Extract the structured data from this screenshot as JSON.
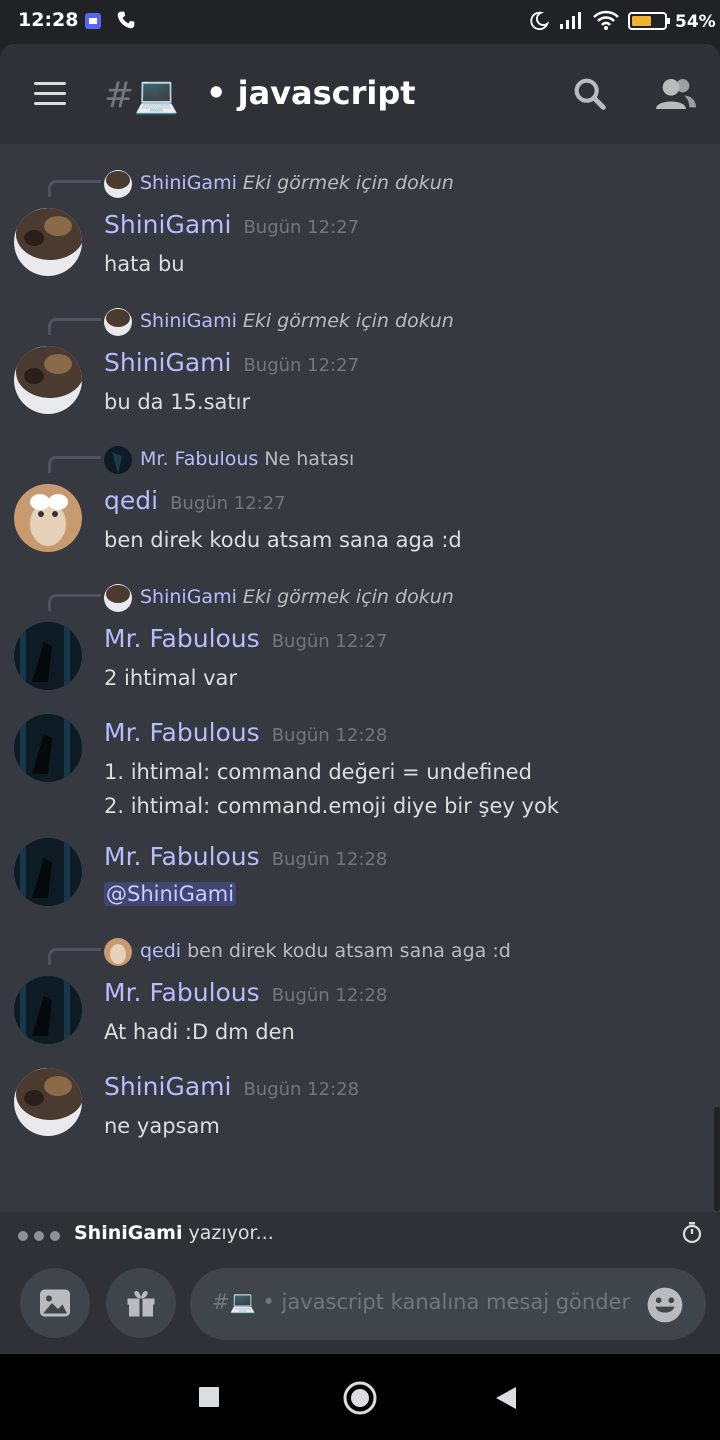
{
  "status_bar": {
    "time": "12:28",
    "battery": "54%"
  },
  "header": {
    "channel_prefix": "#💻",
    "channel_name": "• javascript"
  },
  "messages": [
    {
      "reply": {
        "name": "ShiniGami",
        "hint": "Eki görmek için dokun"
      },
      "author": "ShiniGami",
      "timestamp": "Bugün 12:27",
      "lines": [
        "hata bu"
      ]
    },
    {
      "reply": {
        "name": "ShiniGami",
        "hint": "Eki görmek için dokun"
      },
      "author": "ShiniGami",
      "timestamp": "Bugün 12:27",
      "lines": [
        "bu da 15.satır"
      ]
    },
    {
      "reply": {
        "name": "Mr. Fabulous",
        "content": "Ne hatası"
      },
      "author": "qedi",
      "timestamp": "Bugün 12:27",
      "lines": [
        "ben direk kodu atsam sana aga :d"
      ]
    },
    {
      "reply": {
        "name": "ShiniGami",
        "hint": "Eki görmek için dokun"
      },
      "author": "Mr. Fabulous",
      "timestamp": "Bugün 12:27",
      "lines": [
        "2 ihtimal var"
      ]
    },
    {
      "author": "Mr. Fabulous",
      "timestamp": "Bugün 12:28",
      "lines": [
        "1. ihtimal: command değeri = undefined",
        "2. ihtimal: command.emoji diye bir şey yok"
      ]
    },
    {
      "author": "Mr. Fabulous",
      "timestamp": "Bugün 12:28",
      "mention": "@ShiniGami"
    },
    {
      "reply": {
        "name": "qedi",
        "content": "ben direk kodu atsam sana aga :d"
      },
      "author": "Mr. Fabulous",
      "timestamp": "Bugün 12:28",
      "lines": [
        "At hadi :D dm den"
      ]
    },
    {
      "author": "ShiniGami",
      "timestamp": "Bugün 12:28",
      "lines": [
        "ne yapsam"
      ]
    }
  ],
  "typing": {
    "user": "ShiniGami",
    "suffix": "yazıyor..."
  },
  "composer": {
    "placeholder": "#💻 • javascript kanalına mesaj gönder"
  },
  "colors": {
    "accent_name": "#b9bbfe",
    "background": "#36393f",
    "header": "#2f3136"
  }
}
